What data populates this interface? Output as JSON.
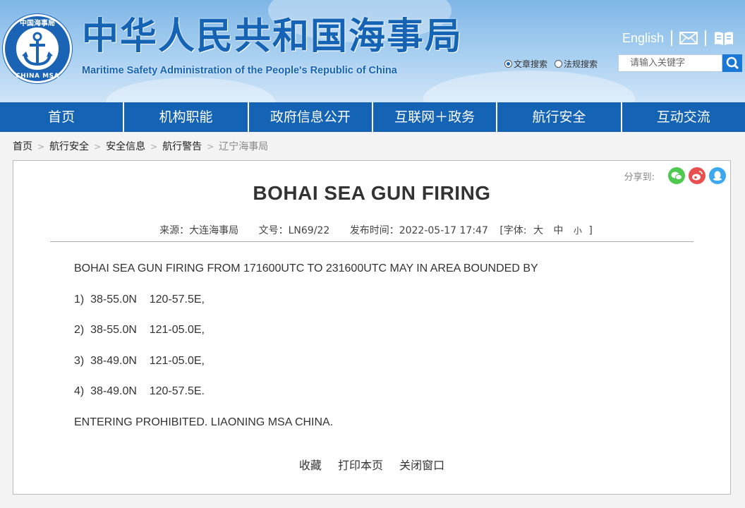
{
  "header": {
    "logo": {
      "top_text": "中国海事局",
      "bottom_text": "CHINA MSA"
    },
    "title_cn": "中华人民共和国海事局",
    "title_en": "Maritime Safety Administration of the People's Republic of China",
    "english_link": "English",
    "search": {
      "options": [
        "文章搜索",
        "法规搜索"
      ],
      "selected": "文章搜索",
      "placeholder": "请输入关键字"
    }
  },
  "nav": {
    "items": [
      "首页",
      "机构职能",
      "政府信息公开",
      "互联网＋政务",
      "航行安全",
      "互动交流"
    ]
  },
  "breadcrumb": [
    "首页",
    "航行安全",
    "安全信息",
    "航行警告",
    "辽宁海事局"
  ],
  "article": {
    "share_label": "分享到:",
    "title": "BOHAI SEA GUN FIRING",
    "source": "来源：大连海事局",
    "doc_no": "文号：LN69/22",
    "publish_time": "发布时间：2022-05-17 17:47",
    "font_label": "[字体:",
    "font_sizes": [
      "大",
      "中",
      "小"
    ],
    "font_close": "]",
    "lines": [
      "BOHAI SEA GUN FIRING FROM 171600UTC TO 231600UTC MAY IN AREA BOUNDED BY",
      "1)  38-55.0N    120-57.5E,",
      "2)  38-55.0N    121-05.0E,",
      "3)  38-49.0N    121-05.0E,",
      "4)  38-49.0N    120-57.5E.",
      "ENTERING PROHIBITED. LIAONING MSA CHINA."
    ],
    "actions": [
      "收藏",
      "打印本页",
      "关闭窗口"
    ]
  },
  "colors": {
    "brand_blue": "#1463b5",
    "header_sky": "#a9d0f1"
  },
  "icons": [
    "mail-icon",
    "book-icon",
    "search-icon",
    "wechat-icon",
    "weibo-icon",
    "qq-icon"
  ]
}
